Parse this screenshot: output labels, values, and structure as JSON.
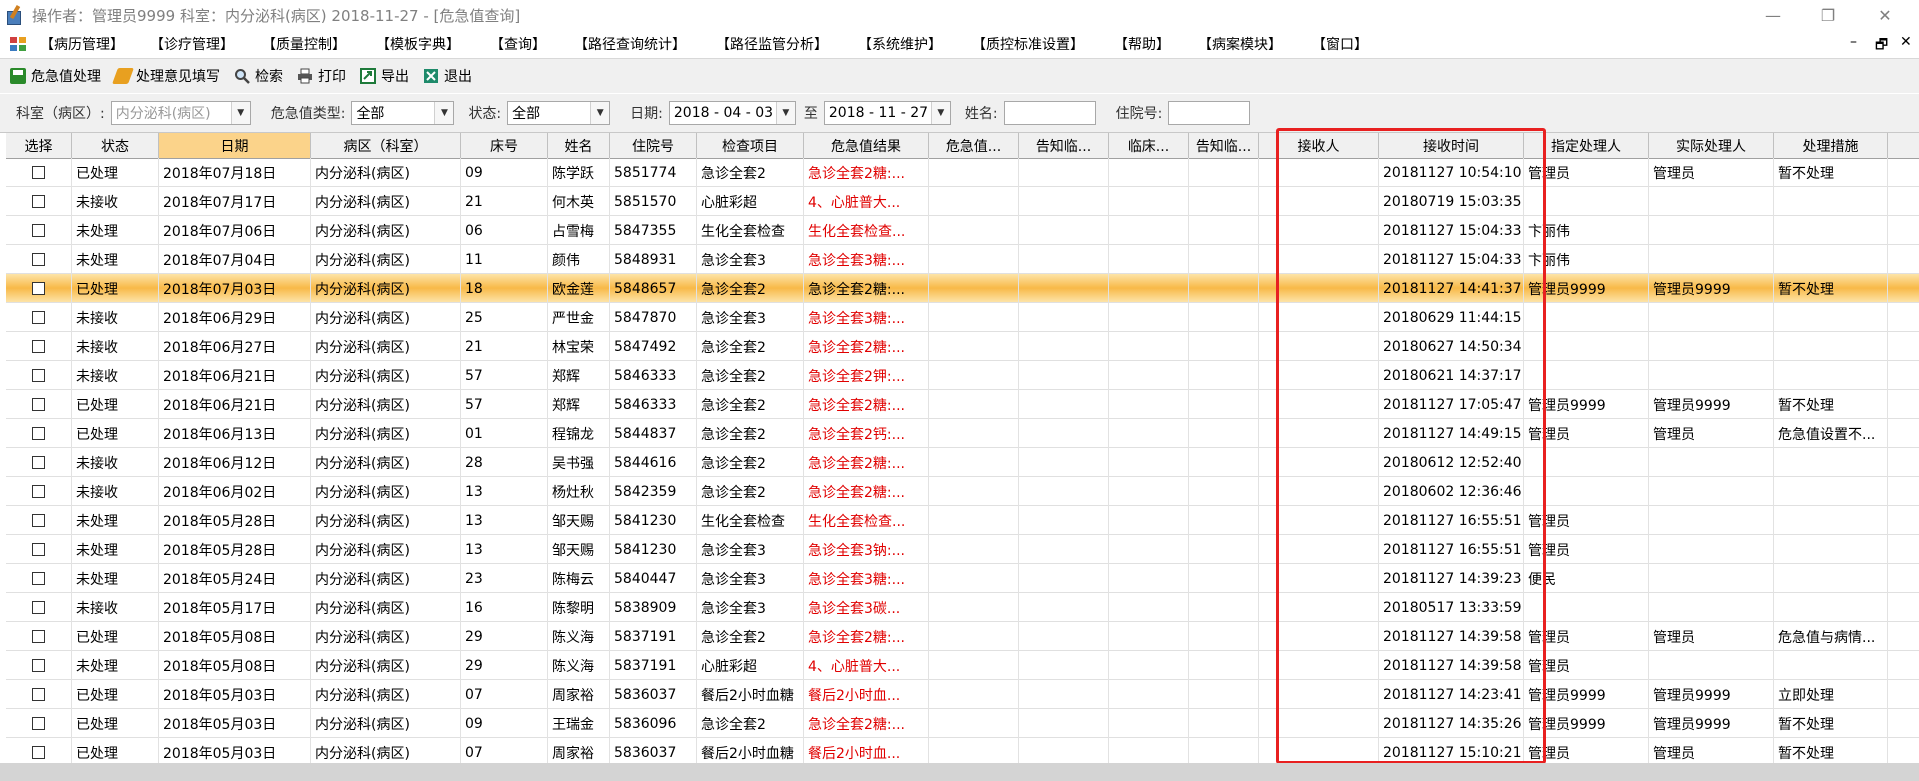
{
  "window": {
    "title": "操作者：管理员9999  科室：内分泌科(病区)  2018-11-27 - [危急值查询]",
    "controls": [
      "—",
      "❐",
      "✕"
    ]
  },
  "menu": {
    "items": [
      "【病历管理】",
      "【诊疗管理】",
      "【质量控制】",
      "【模板字典】",
      "【查询】",
      "【路径查询统计】",
      "【路径监管分析】",
      "【系统维护】",
      "【质控标准设置】",
      "【帮助】",
      "【病案模块】",
      "【窗口】"
    ],
    "mdi_controls": [
      "–",
      "🗗",
      "✕"
    ]
  },
  "toolbar": {
    "buttons": [
      {
        "label": "危急值处理",
        "icon": "save-icon",
        "color": "#2a8a2a"
      },
      {
        "label": "处理意见填写",
        "icon": "eraser-icon",
        "color": "#e8a020"
      },
      {
        "label": "检索",
        "icon": "search-icon",
        "color": "#555555"
      },
      {
        "label": "打印",
        "icon": "printer-icon",
        "color": "#444444"
      },
      {
        "label": "导出",
        "icon": "export-icon",
        "color": "#1e7a3a"
      },
      {
        "label": "退出",
        "icon": "exit-icon",
        "color": "#1e8a6a"
      }
    ]
  },
  "filters": {
    "dept_label": "科室（病区）:",
    "dept_value": "内分泌科(病区)",
    "type_label": "危急值类型:",
    "type_value": "全部",
    "status_label": "状态:",
    "status_value": "全部",
    "date_label": "日期:",
    "date_from": "2018 - 04 - 03",
    "date_to_label": "至",
    "date_to": "2018 - 11 - 27",
    "name_label": "姓名:",
    "name_value": "",
    "inpatient_label": "住院号:",
    "inpatient_value": ""
  },
  "table": {
    "headers": [
      "选择",
      "状态",
      "日期",
      "病区（科室）",
      "床号",
      "姓名",
      "住院号",
      "检查项目",
      "危急值结果",
      "危急值...",
      "告知临...",
      "临床...",
      "告知临...",
      "接收人",
      "接收时间",
      "指定处理人",
      "实际处理人",
      "处理措施"
    ],
    "sorted_column": "日期",
    "selected_row": 4,
    "rows": [
      [
        "",
        "已处理",
        "2018年07月18日",
        "内分泌科(病区)",
        "09",
        "陈学跃",
        "5851774",
        "急诊全套2",
        "急诊全套2糖:...",
        "",
        "",
        "",
        "",
        "",
        "20181127 10:54:10",
        "管理员",
        "管理员",
        "暂不处理"
      ],
      [
        "",
        "未接收",
        "2018年07月17日",
        "内分泌科(病区)",
        "21",
        "何木英",
        "5851570",
        "心脏彩超",
        "4、心脏普大...",
        "",
        "",
        "",
        "",
        "",
        "20180719 15:03:35",
        "",
        "",
        ""
      ],
      [
        "",
        "未处理",
        "2018年07月06日",
        "内分泌科(病区)",
        "06",
        "占雪梅",
        "5847355",
        "生化全套检查",
        "生化全套检查...",
        "",
        "",
        "",
        "",
        "",
        "20181127 15:04:33",
        "卞丽伟",
        "",
        ""
      ],
      [
        "",
        "未处理",
        "2018年07月04日",
        "内分泌科(病区)",
        "11",
        "颜伟",
        "5848931",
        "急诊全套3",
        "急诊全套3糖:...",
        "",
        "",
        "",
        "",
        "",
        "20181127 15:04:33",
        "卞丽伟",
        "",
        ""
      ],
      [
        "",
        "已处理",
        "2018年07月03日",
        "内分泌科(病区)",
        "18",
        "欧金莲",
        "5848657",
        "急诊全套2",
        "急诊全套2糖:...",
        "",
        "",
        "",
        "",
        "",
        "20181127 14:41:37",
        "管理员9999",
        "管理员9999",
        "暂不处理"
      ],
      [
        "",
        "未接收",
        "2018年06月29日",
        "内分泌科(病区)",
        "25",
        "严世金",
        "5847870",
        "急诊全套3",
        "急诊全套3糖:...",
        "",
        "",
        "",
        "",
        "",
        "20180629 11:44:15",
        "",
        "",
        ""
      ],
      [
        "",
        "未接收",
        "2018年06月27日",
        "内分泌科(病区)",
        "21",
        "林宝荣",
        "5847492",
        "急诊全套2",
        "急诊全套2糖:...",
        "",
        "",
        "",
        "",
        "",
        "20180627 14:50:34",
        "",
        "",
        ""
      ],
      [
        "",
        "未接收",
        "2018年06月21日",
        "内分泌科(病区)",
        "57",
        "郑辉",
        "5846333",
        "急诊全套2",
        "急诊全套2钾:...",
        "",
        "",
        "",
        "",
        "",
        "20180621 14:37:17",
        "",
        "",
        ""
      ],
      [
        "",
        "已处理",
        "2018年06月21日",
        "内分泌科(病区)",
        "57",
        "郑辉",
        "5846333",
        "急诊全套2",
        "急诊全套2糖:...",
        "",
        "",
        "",
        "",
        "",
        "20181127 17:05:47",
        "管理员9999",
        "管理员9999",
        "暂不处理"
      ],
      [
        "",
        "已处理",
        "2018年06月13日",
        "内分泌科(病区)",
        "01",
        "程锦龙",
        "5844837",
        "急诊全套2",
        "急诊全套2钙:...",
        "",
        "",
        "",
        "",
        "",
        "20181127 14:49:15",
        "管理员",
        "管理员",
        "危急值设置不..."
      ],
      [
        "",
        "未接收",
        "2018年06月12日",
        "内分泌科(病区)",
        "28",
        "吴书强",
        "5844616",
        "急诊全套2",
        "急诊全套2糖:...",
        "",
        "",
        "",
        "",
        "",
        "20180612 12:52:40",
        "",
        "",
        ""
      ],
      [
        "",
        "未接收",
        "2018年06月02日",
        "内分泌科(病区)",
        "13",
        "杨灶秋",
        "5842359",
        "急诊全套2",
        "急诊全套2糖:...",
        "",
        "",
        "",
        "",
        "",
        "20180602 12:36:46",
        "",
        "",
        ""
      ],
      [
        "",
        "未处理",
        "2018年05月28日",
        "内分泌科(病区)",
        "13",
        "邹天赐",
        "5841230",
        "生化全套检查",
        "生化全套检查...",
        "",
        "",
        "",
        "",
        "",
        "20181127 16:55:51",
        "管理员",
        "",
        ""
      ],
      [
        "",
        "未处理",
        "2018年05月28日",
        "内分泌科(病区)",
        "13",
        "邹天赐",
        "5841230",
        "急诊全套3",
        "急诊全套3钠:...",
        "",
        "",
        "",
        "",
        "",
        "20181127 16:55:51",
        "管理员",
        "",
        ""
      ],
      [
        "",
        "未处理",
        "2018年05月24日",
        "内分泌科(病区)",
        "23",
        "陈梅云",
        "5840447",
        "急诊全套3",
        "急诊全套3糖:...",
        "",
        "",
        "",
        "",
        "",
        "20181127 14:39:23",
        "便民",
        "",
        ""
      ],
      [
        "",
        "未接收",
        "2018年05月17日",
        "内分泌科(病区)",
        "16",
        "陈黎明",
        "5838909",
        "急诊全套3",
        "急诊全套3碳...",
        "",
        "",
        "",
        "",
        "",
        "20180517 13:33:59",
        "",
        "",
        ""
      ],
      [
        "",
        "已处理",
        "2018年05月08日",
        "内分泌科(病区)",
        "29",
        "陈义海",
        "5837191",
        "急诊全套2",
        "急诊全套2糖:...",
        "",
        "",
        "",
        "",
        "",
        "20181127 14:39:58",
        "管理员",
        "管理员",
        "危急值与病情..."
      ],
      [
        "",
        "未处理",
        "2018年05月08日",
        "内分泌科(病区)",
        "29",
        "陈义海",
        "5837191",
        "心脏彩超",
        "4、心脏普大...",
        "",
        "",
        "",
        "",
        "",
        "20181127 14:39:58",
        "管理员",
        "",
        ""
      ],
      [
        "",
        "已处理",
        "2018年05月03日",
        "内分泌科(病区)",
        "07",
        "周家裕",
        "5836037",
        "餐后2小时血糖",
        "餐后2小时血...",
        "",
        "",
        "",
        "",
        "",
        "20181127 14:23:41",
        "管理员9999",
        "管理员9999",
        "立即处理"
      ],
      [
        "",
        "已处理",
        "2018年05月03日",
        "内分泌科(病区)",
        "09",
        "王瑞金",
        "5836096",
        "急诊全套2",
        "急诊全套2糖:...",
        "",
        "",
        "",
        "",
        "",
        "20181127 14:35:26",
        "管理员9999",
        "管理员9999",
        "暂不处理"
      ],
      [
        "",
        "已处理",
        "2018年05月03日",
        "内分泌科(病区)",
        "07",
        "周家裕",
        "5836037",
        "餐后2小时血糖",
        "餐后2小时血...",
        "",
        "",
        "",
        "",
        "",
        "20181127 15:10:21",
        "管理员",
        "管理员",
        "暂不处理"
      ]
    ]
  },
  "colors": {
    "critical_text": "#e00000",
    "selected_row": "#f8b948",
    "sorted_header": "#fbd38a",
    "annotation_box": "#e82020"
  }
}
